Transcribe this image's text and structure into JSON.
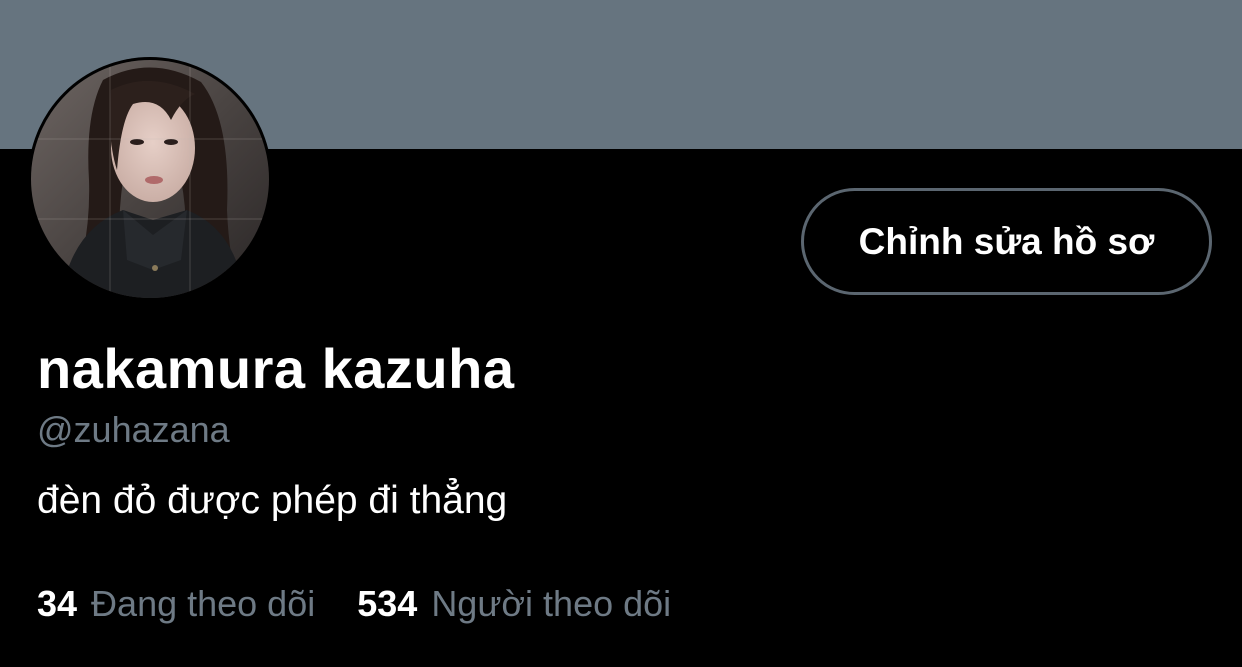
{
  "colors": {
    "banner": "#66747f",
    "background": "#000000",
    "primary_text": "#ffffff",
    "secondary_text": "#6e7a85",
    "button_border": "#5b6670"
  },
  "profile": {
    "avatar_icon": "profile-photo",
    "edit_button_label": "Chỉnh sửa hồ sơ",
    "display_name": "nakamura kazuha",
    "handle": "@zuhazana",
    "bio": "đèn đỏ được phép đi thẳng"
  },
  "stats": {
    "following_count": "34",
    "following_label": "Đang theo dõi",
    "followers_count": "534",
    "followers_label": "Người theo dõi"
  }
}
